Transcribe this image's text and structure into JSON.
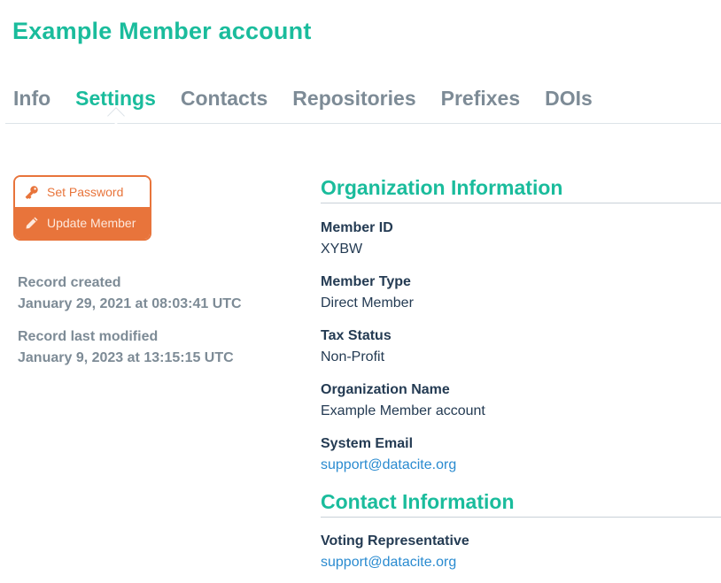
{
  "title": "Example Member account",
  "tabs": [
    {
      "label": "Info"
    },
    {
      "label": "Settings"
    },
    {
      "label": "Contacts"
    },
    {
      "label": "Repositories"
    },
    {
      "label": "Prefixes"
    },
    {
      "label": "DOIs"
    }
  ],
  "active_tab": "Settings",
  "actions": {
    "set_password_label": "Set Password",
    "set_password_icon": "key-icon",
    "update_member_label": "Update Member",
    "update_member_icon": "pencil-icon"
  },
  "record": {
    "created_label": "Record created",
    "created_value": "January 29, 2021 at 08:03:41 UTC",
    "modified_label": "Record last modified",
    "modified_value": "January 9, 2023 at 13:15:15 UTC"
  },
  "organization": {
    "heading": "Organization Information",
    "fields": [
      {
        "label": "Member ID",
        "value": "XYBW"
      },
      {
        "label": "Member Type",
        "value": "Direct Member"
      },
      {
        "label": "Tax Status",
        "value": "Non-Profit"
      },
      {
        "label": "Organization Name",
        "value": "Example Member account"
      },
      {
        "label": "System Email",
        "value": "support@datacite.org"
      }
    ]
  },
  "contact": {
    "heading": "Contact Information",
    "fields": [
      {
        "label": "Voting Representative",
        "value": "support@datacite.org"
      }
    ]
  },
  "colors": {
    "accent": "#1abc9c",
    "orange": "#e8743b",
    "link": "#2a8bd0",
    "muted": "#7d8b96"
  }
}
